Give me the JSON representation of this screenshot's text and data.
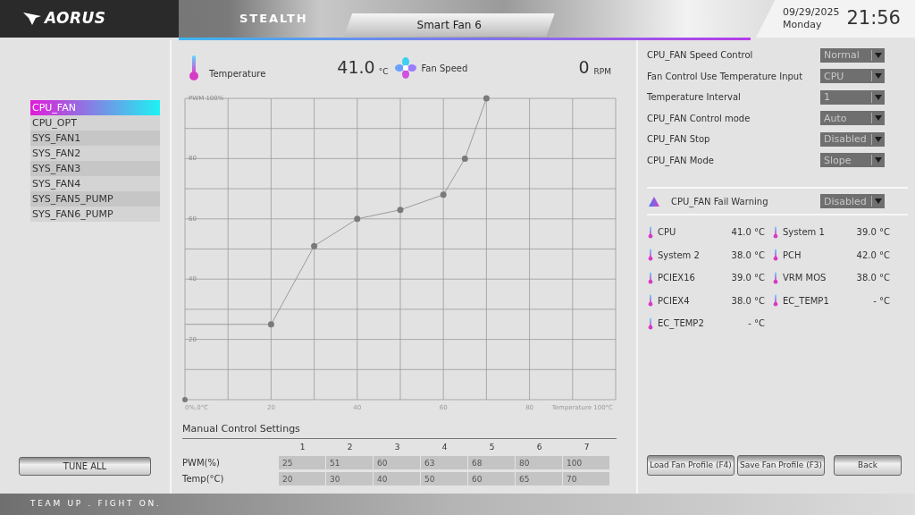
{
  "header": {
    "logo": "AORUS",
    "model": "STEALTH",
    "tab": "Smart Fan 6",
    "date": "09/29/2025",
    "weekday": "Monday",
    "time": "21:56"
  },
  "readings": {
    "temperature_label": "Temperature",
    "temperature_value": "41.0",
    "temperature_unit": "°C",
    "fan_label": "Fan Speed",
    "fan_value": "0",
    "fan_unit": "RPM"
  },
  "fans": [
    {
      "label": "CPU_FAN",
      "selected": true
    },
    {
      "label": "CPU_OPT",
      "selected": false
    },
    {
      "label": "SYS_FAN1",
      "selected": false
    },
    {
      "label": "SYS_FAN2",
      "selected": false
    },
    {
      "label": "SYS_FAN3",
      "selected": false
    },
    {
      "label": "SYS_FAN4",
      "selected": false
    },
    {
      "label": "SYS_FAN5_PUMP",
      "selected": false
    },
    {
      "label": "SYS_FAN6_PUMP",
      "selected": false
    }
  ],
  "tune_all": "TUNE ALL",
  "chart": {
    "chart_data": {
      "type": "line",
      "x": [
        0,
        20,
        30,
        40,
        50,
        60,
        65,
        70
      ],
      "grid": true,
      "series": [
        {
          "color": "#9a9a9a",
          "marker": "circle",
          "values": [
            25,
            25,
            51,
            60,
            63,
            68,
            80,
            100
          ]
        },
        {
          "color": "#7a7a7a",
          "marker": "circle",
          "values": [
            0,
            null,
            null,
            null,
            null,
            null,
            null,
            null
          ]
        }
      ],
      "xlim": [
        0,
        100
      ],
      "ylim": [
        0,
        100
      ],
      "xticks": [
        {
          "value": 0,
          "label": "0%,0°C"
        },
        20,
        40,
        60,
        80,
        {
          "value": 100,
          "label": "Temperature 100°C"
        }
      ],
      "yticks": [
        20,
        40,
        60,
        80,
        {
          "value": 100,
          "label": "PWM 100%"
        }
      ]
    }
  },
  "manual": {
    "title": "Manual Control Settings",
    "columns": [
      "1",
      "2",
      "3",
      "4",
      "5",
      "6",
      "7"
    ],
    "rows": [
      {
        "label": "PWM(%)",
        "values": [
          "25",
          "51",
          "60",
          "63",
          "68",
          "80",
          "100"
        ]
      },
      {
        "label": "Temp(°C)",
        "values": [
          "20",
          "30",
          "40",
          "50",
          "60",
          "65",
          "70"
        ]
      }
    ]
  },
  "settings": [
    {
      "label": "CPU_FAN Speed Control",
      "value": "Normal"
    },
    {
      "label": "Fan Control Use Temperature Input",
      "value": "CPU"
    },
    {
      "label": "Temperature Interval",
      "value": "1"
    },
    {
      "label": "CPU_FAN Control mode",
      "value": "Auto"
    },
    {
      "label": "CPU_FAN Stop",
      "value": "Disabled"
    },
    {
      "label": "CPU_FAN Mode",
      "value": "Slope"
    }
  ],
  "fail_warning": {
    "label": "CPU_FAN Fail Warning",
    "value": "Disabled"
  },
  "sensors": [
    {
      "name": "CPU",
      "value": "41.0 °C"
    },
    {
      "name": "System 1",
      "value": "39.0 °C"
    },
    {
      "name": "System 2",
      "value": "38.0 °C"
    },
    {
      "name": "PCH",
      "value": "42.0 °C"
    },
    {
      "name": "PCIEX16",
      "value": "39.0 °C"
    },
    {
      "name": "VRM MOS",
      "value": "38.0 °C"
    },
    {
      "name": "PCIEX4",
      "value": "38.0 °C"
    },
    {
      "name": "EC_TEMP1",
      "value": "- °C"
    },
    {
      "name": "EC_TEMP2",
      "value": "- °C"
    }
  ],
  "buttons": [
    "Load Fan Profile (F4)",
    "Save Fan Profile (F3)",
    "Back"
  ],
  "footer": "TEAM UP . FIGHT ON."
}
